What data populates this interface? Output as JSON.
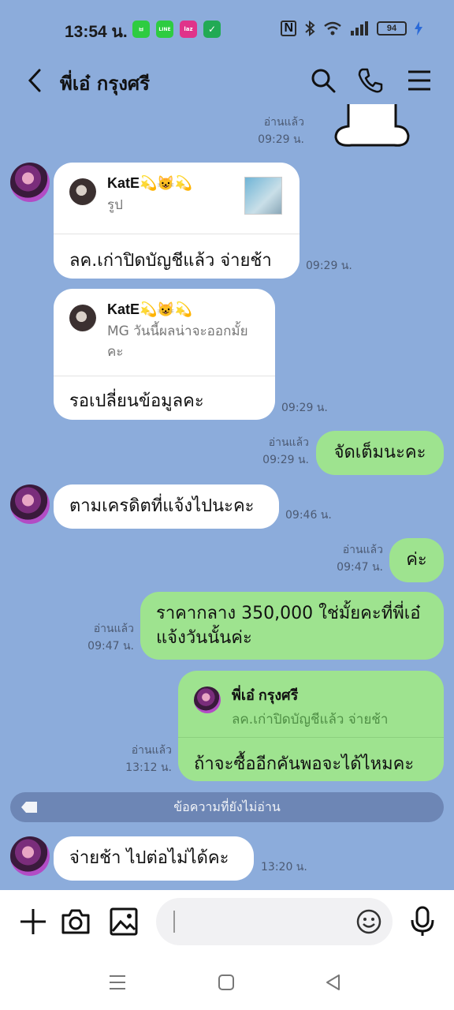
{
  "status_bar": {
    "time": "13:54 น.",
    "battery": "94",
    "app_icons": [
      {
        "name": "line-app-icon",
        "glyph": "L",
        "color": "#2ecc40"
      },
      {
        "name": "line-chat-icon",
        "glyph": "LINE",
        "color": "#2ecc40"
      },
      {
        "name": "lazada-icon",
        "glyph": "laz",
        "color": "#e0338a"
      },
      {
        "name": "shield-app-icon",
        "glyph": "✓",
        "color": "#22aa55"
      }
    ]
  },
  "header": {
    "title": "พี่เอ๋ กรุงศรี"
  },
  "messages": {
    "top_read": {
      "read": "อ่านแล้ว",
      "time": "09:29 น."
    },
    "m1": {
      "reply_name": "KatE💫😺💫",
      "reply_sub": "รูป",
      "body": "ลค.เก่าปิดบัญชีแล้ว จ่ายช้า",
      "time": "09:29 น."
    },
    "m2": {
      "reply_name": "KatE💫😺💫",
      "reply_sub": "MG วันนี้ผลน่าจะออกมั้ยคะ",
      "body": "รอเปลี่ยนข้อมูลคะ",
      "time": "09:29 น."
    },
    "m3": {
      "body": "จัดเต็มนะคะ",
      "read": "อ่านแล้ว",
      "time": "09:29 น."
    },
    "m4": {
      "body": "ตามเครดิตที่แจ้งไปนะคะ",
      "time": "09:46 น."
    },
    "m5": {
      "body": "ค่ะ",
      "read": "อ่านแล้ว",
      "time": "09:47 น."
    },
    "m6": {
      "body_line1": "ราคากลาง 350,000 ใช่มั้ยคะที่พี่เอ๋",
      "body_line2": "แจ้งวันนั้นค่ะ",
      "read": "อ่านแล้ว",
      "time": "09:47 น."
    },
    "m7": {
      "reply_name": "พี่เอ๋ กรุงศรี",
      "reply_sub": "ลค.เก่าปิดบัญชีแล้ว จ่ายช้า",
      "body": "ถ้าจะซื้ออีกคันพอจะได้ไหมคะ",
      "read": "อ่านแล้ว",
      "time": "13:12 น."
    },
    "unread_label": "ข้อความที่ยังไม่อ่าน",
    "m8": {
      "body": "จ่ายช้า ไปต่อไม่ได้คะ",
      "time": "13:20 น."
    }
  }
}
